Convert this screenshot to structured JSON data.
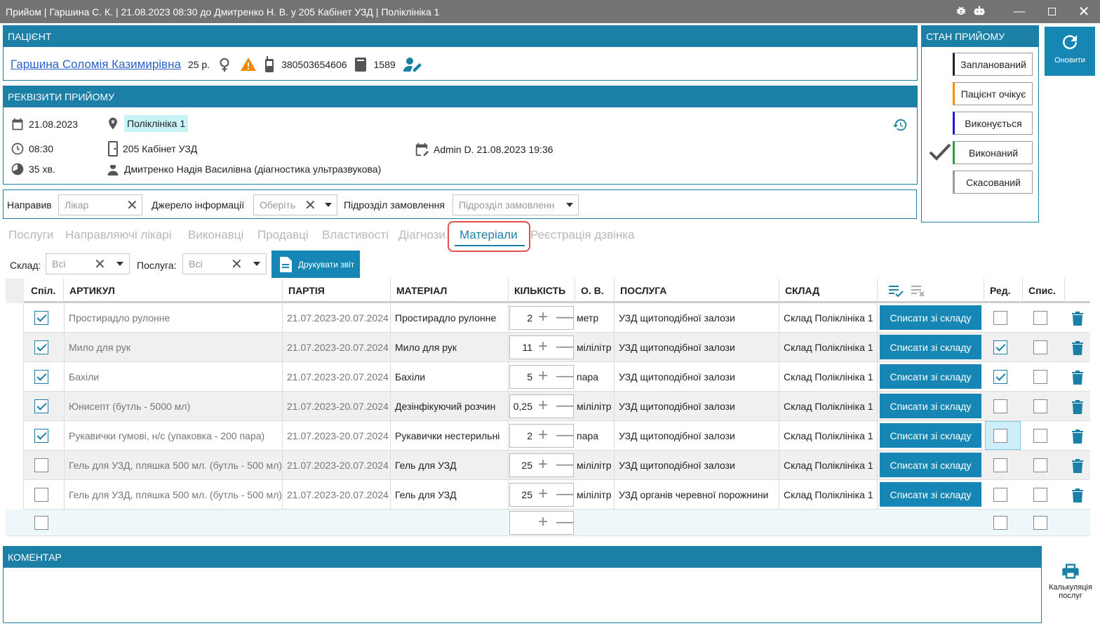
{
  "window": {
    "title": "Прийом | Гаршина С. К. | 21.08.2023 08:30 до Дмитренко Н. В. у 205 Кабінет УЗД | Поліклініка 1",
    "controls": [
      "minimize-icon",
      "maximize-icon",
      "close-icon"
    ]
  },
  "patient": {
    "header": "ПАЦІЄНТ",
    "name": "Гаршина Соломія Казимирівна",
    "age": "25 р.",
    "phone": "380503654606",
    "card_number": "1589"
  },
  "details": {
    "header": "РЕКВІЗИТИ ПРИЙОМУ",
    "date": "21.08.2023",
    "clinic": "Поліклініка 1",
    "time": "08:30",
    "room": "205 Кабінет УЗД",
    "edited": "Admin D. 21.08.2023 19:36",
    "duration": "35 хв.",
    "doctor": "Дмитренко Надія Василівна (діагностика ультразвукова)"
  },
  "state": {
    "header": "СТАН ПРИЙОМУ",
    "options": [
      {
        "label": "Запланований",
        "color": "#222222"
      },
      {
        "label": "Пацієнт очікує",
        "color": "#ff8c00"
      },
      {
        "label": "Виконується",
        "color": "#1a1ad6"
      },
      {
        "label": "Виконаний",
        "color": "#2e9c3c"
      },
      {
        "label": "Скасований",
        "color": "#9a9a9a"
      }
    ],
    "active": "Виконаний"
  },
  "refresh_label": "Оновити",
  "filters": {
    "referred_label": "Направив",
    "referred_placeholder": "Лікар",
    "source_label": "Джерело інформації",
    "source_placeholder": "Оберіть",
    "division_label": "Підрозділ замовлення",
    "division_placeholder": "Підрозділ замовленн"
  },
  "tabs": [
    "Послуги",
    "Направляючі лікарі",
    "Виконавці",
    "Продавці",
    "Властивості",
    "Діагнози",
    "Матеріали",
    "Реєстрація дзвінка"
  ],
  "active_tab": "Матеріали",
  "toolbar": {
    "warehouse_label": "Склад:",
    "warehouse_value": "Всі",
    "service_label": "Послуга:",
    "service_value": "Всі",
    "print_label": "Друкувати звіт"
  },
  "table": {
    "headers": [
      "Спіл.",
      "АРТИКУЛ",
      "ПАРТІЯ",
      "МАТЕРІАЛ",
      "КІЛЬКІСТЬ",
      "О. В.",
      "ПОСЛУГА",
      "СКЛАД",
      "",
      "Ред.",
      "Спис."
    ],
    "button_label": "Списати зі складу",
    "rows": [
      {
        "shared": true,
        "article": "Простирадло рулонне",
        "batch": "21.07.2023-20.07.2024",
        "material": "Простирадло рулонне",
        "qty": "2",
        "unit": "метр",
        "service": "УЗД щитоподібної залози",
        "warehouse": "Склад Поліклініка 1",
        "edit": false,
        "written": false
      },
      {
        "shared": true,
        "article": "Мило для рук",
        "batch": "21.07.2023-20.07.2024",
        "material": "Мило для рук",
        "qty": "11",
        "unit": "мілілітр",
        "service": "УЗД щитоподібної залози",
        "warehouse": "Склад Поліклініка 1",
        "edit": true,
        "written": false
      },
      {
        "shared": true,
        "article": "Бахіли",
        "batch": "21.07.2023-20.07.2024",
        "material": "Бахіли",
        "qty": "5",
        "unit": "пара",
        "service": "УЗД щитоподібної залози",
        "warehouse": "Склад Поліклініка 1",
        "edit": true,
        "written": false
      },
      {
        "shared": true,
        "article": "Юнисепт (бутль - 5000 мл)",
        "batch": "21.07.2023-20.07.2024",
        "material": "Дезінфікуючий розчин",
        "qty": "0,25",
        "unit": "мілілітр",
        "service": "УЗД щитоподібної залози",
        "warehouse": "Склад Поліклініка 1",
        "edit": false,
        "written": false
      },
      {
        "shared": true,
        "article": "Рукавички гумові, н/с (упаковка - 200 пара)",
        "batch": "21.07.2023-20.07.2024",
        "material": "Рукавички нестерильні",
        "qty": "2",
        "unit": "пара",
        "service": "УЗД щитоподібної залози",
        "warehouse": "Склад Поліклініка 1",
        "edit": false,
        "written": false
      },
      {
        "shared": false,
        "article": "Гель для УЗД, пляшка 500 мл. (бутль - 500 мл)",
        "batch": "21.07.2023-20.07.2024",
        "material": "Гель для УЗД",
        "qty": "25",
        "unit": "мілілітр",
        "service": "УЗД щитоподібної залози",
        "warehouse": "Склад Поліклініка 1",
        "edit": false,
        "written": false
      },
      {
        "shared": false,
        "article": "Гель для УЗД, пляшка 500 мл. (бутль - 500 мл)",
        "batch": "21.07.2023-20.07.2024",
        "material": "Гель для УЗД",
        "qty": "25",
        "unit": "мілілітр",
        "service": "УЗД органів черевної порожнини",
        "warehouse": "Склад Поліклініка 1",
        "edit": false,
        "written": false
      }
    ]
  },
  "comment": {
    "header": "КОМЕНТАР"
  },
  "calc_label_1": "Калькуляція",
  "calc_label_2": "послуг",
  "colors": {
    "accent": "#1b7fa6",
    "button": "#1687b5",
    "highlight": "#e05050"
  }
}
